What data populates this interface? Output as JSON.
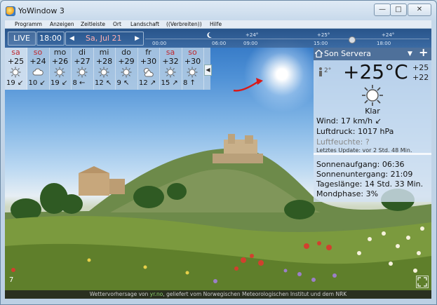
{
  "window": {
    "title": "YoWindow 3",
    "controls": {
      "minimize": "—",
      "maximize": "□",
      "close": "✕"
    }
  },
  "menu": [
    "Programm",
    "Anzeigen",
    "Zeitleiste",
    "Ort",
    "Landschaft",
    "((Verbreiten))",
    "Hilfe"
  ],
  "toolbar": {
    "live_label": "LIVE",
    "time": "18:00",
    "prev": "◀",
    "date": "Sa, Jul 21",
    "next": "▶"
  },
  "timeline": {
    "times": [
      "00:00",
      "06:00",
      "09:00",
      "15:00",
      "18:00"
    ],
    "highs": [
      "+24°",
      "+25°",
      "+24°"
    ]
  },
  "forecast": [
    {
      "day": "sa",
      "high": "+25",
      "low": "19",
      "arrow": "↙",
      "icon": "sun-icon",
      "weekend": true,
      "selected": true
    },
    {
      "day": "so",
      "high": "+24",
      "low": "10",
      "arrow": "↙",
      "icon": "cloud-icon",
      "weekend": true,
      "selected": false
    },
    {
      "day": "mo",
      "high": "+26",
      "low": "19",
      "arrow": "↙",
      "icon": "sun-icon",
      "weekend": false,
      "selected": false
    },
    {
      "day": "di",
      "high": "+27",
      "low": "8",
      "arrow": "←",
      "icon": "sun-icon",
      "weekend": false,
      "selected": false
    },
    {
      "day": "mi",
      "high": "+28",
      "low": "12",
      "arrow": "↖",
      "icon": "sun-icon",
      "weekend": false,
      "selected": false
    },
    {
      "day": "do",
      "high": "+29",
      "low": "9",
      "arrow": "↖",
      "icon": "sun-icon",
      "weekend": false,
      "selected": false
    },
    {
      "day": "fr",
      "high": "+30",
      "low": "12",
      "arrow": "↗",
      "icon": "sun-cloud-icon",
      "weekend": false,
      "selected": false
    },
    {
      "day": "sa",
      "high": "+32",
      "low": "15",
      "arrow": "↗",
      "icon": "sun-icon",
      "weekend": true,
      "selected": false
    },
    {
      "day": "so",
      "high": "+30",
      "low": "8",
      "arrow": "↑",
      "icon": "sun-icon",
      "weekend": true,
      "selected": false
    }
  ],
  "forecast_collapse": "◀",
  "panel": {
    "location": "Son Servera",
    "dropdown": "▼",
    "add": "+",
    "feels": "2°",
    "temp": "+25°C",
    "high": "+25",
    "low": "+22",
    "condition": "Klar",
    "wind": "Wind:  17 km/h ↙",
    "pressure": "Luftdruck:  1017 hPa",
    "humidity": "Luftfeuchte:  ?",
    "updated": "Letztes Update:  vor 2 Std. 48 Min.",
    "sunrise": "Sonnenaufgang:  06:36",
    "sunset": "Sonnenuntergang:  21:09",
    "daylength": "Tageslänge:  14 Std. 33 Min.",
    "moon": "Mondphase:  3%"
  },
  "footer": {
    "prefix": "Wettervorhersage von ",
    "link": "yr.no",
    "suffix": ", geliefert vom Norwegischen Meteorologischen Institut und dem NRK"
  },
  "corner_number": "7",
  "colors": {
    "weekend": "#c0282f",
    "weekday": "#1a1a1a",
    "accent": "#3a6aa0"
  }
}
